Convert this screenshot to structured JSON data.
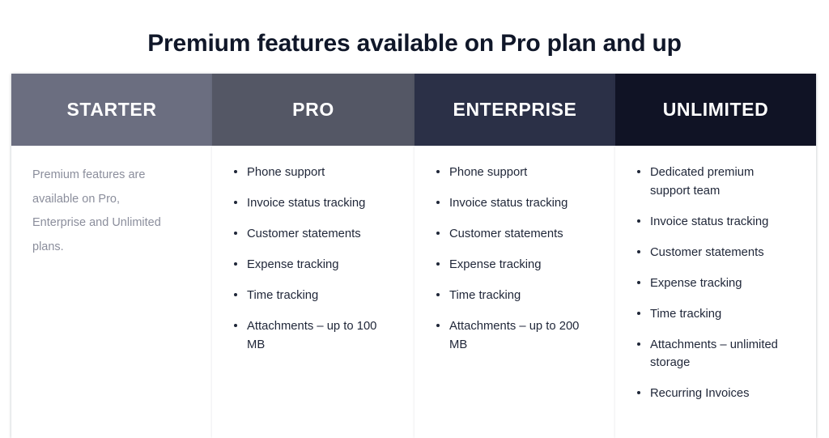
{
  "page": {
    "title": "Premium features available on Pro plan and up",
    "background_color": "#ffffff",
    "title_color": "#101729"
  },
  "plans": [
    {
      "name": "STARTER",
      "header_color": "#6b6e80",
      "body_type": "note",
      "note": "Premium features are available on Pro, Enterprise and Unlimited plans.",
      "features": []
    },
    {
      "name": "PRO",
      "header_color": "#545765",
      "body_type": "list",
      "note": "",
      "features": [
        "Phone support",
        "Invoice status tracking",
        "Customer statements",
        "Expense tracking",
        "Time tracking",
        "Attachments – up to 100 MB"
      ]
    },
    {
      "name": "ENTERPRISE",
      "header_color": "#2b3047",
      "body_type": "list",
      "note": "",
      "features": [
        "Phone support",
        "Invoice status tracking",
        "Customer statements",
        "Expense tracking",
        "Time tracking",
        "Attachments – up to 200 MB"
      ]
    },
    {
      "name": "UNLIMITED",
      "header_color": "#101325",
      "body_type": "list",
      "note": "",
      "features": [
        "Dedicated premium support team",
        "Invoice status tracking",
        "Customer statements",
        "Expense tracking",
        "Time tracking",
        "Attachments – unlimited storage",
        "Recurring Invoices"
      ]
    }
  ]
}
